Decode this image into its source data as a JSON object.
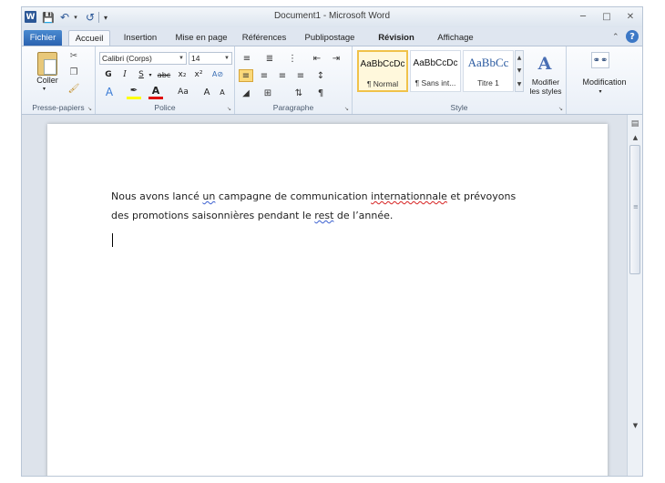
{
  "window": {
    "title": "Document1 - Microsoft Word",
    "logo_letter": "W"
  },
  "quick_access": {
    "save_icon": "save-icon",
    "undo_icon": "undo-icon",
    "redo_icon": "redo-icon"
  },
  "tabs": [
    {
      "label": "Fichier"
    },
    {
      "label": "Accueil"
    },
    {
      "label": "Insertion"
    },
    {
      "label": "Mise en page"
    },
    {
      "label": "Références"
    },
    {
      "label": "Publipostage"
    },
    {
      "label": "Révision"
    },
    {
      "label": "Affichage"
    }
  ],
  "ribbon": {
    "clipboard": {
      "group_label": "Presse-papiers",
      "paste_label": "Coller"
    },
    "font": {
      "group_label": "Police",
      "font_name": "Calibri (Corps)",
      "font_size": "14",
      "bold": "G",
      "italic": "I",
      "underline": "S",
      "strike": "abc",
      "subscript": "x₂",
      "superscript": "x²",
      "change_case": "Aa",
      "grow": "A",
      "shrink": "A",
      "font_color_letter": "A"
    },
    "paragraph": {
      "group_label": "Paragraphe"
    },
    "styles": {
      "group_label": "Style",
      "items": [
        {
          "sample": "AaBbCcDc",
          "name": "¶ Normal",
          "selected": true
        },
        {
          "sample": "AaBbCcDc",
          "name": "¶ Sans int...",
          "selected": false
        },
        {
          "sample": "AaBbCc",
          "name": "Titre 1",
          "selected": false
        }
      ],
      "change_styles_line1": "Modifier",
      "change_styles_line2": "les styles"
    },
    "editing": {
      "label": "Modification"
    }
  },
  "document": {
    "paragraph": [
      {
        "text": "Nous avons lancé ",
        "mark": "none"
      },
      {
        "text": "un",
        "mark": "grammar"
      },
      {
        "text": " campagne de communication ",
        "mark": "none"
      },
      {
        "text": "internationnale",
        "mark": "spelling"
      },
      {
        "text": " et prévoyons des promotions saisonnières pendant le ",
        "mark": "none"
      },
      {
        "text": "rest",
        "mark": "grammar"
      },
      {
        "text": " de l’année.",
        "mark": "none"
      }
    ]
  },
  "colors": {
    "file_tab": "#2a62b0",
    "selected_style_border": "#f0c24a",
    "highlight": "#ffff00",
    "font_color": "#e01010",
    "spelling_underline": "#d62020",
    "grammar_underline": "#3a5fd0"
  }
}
